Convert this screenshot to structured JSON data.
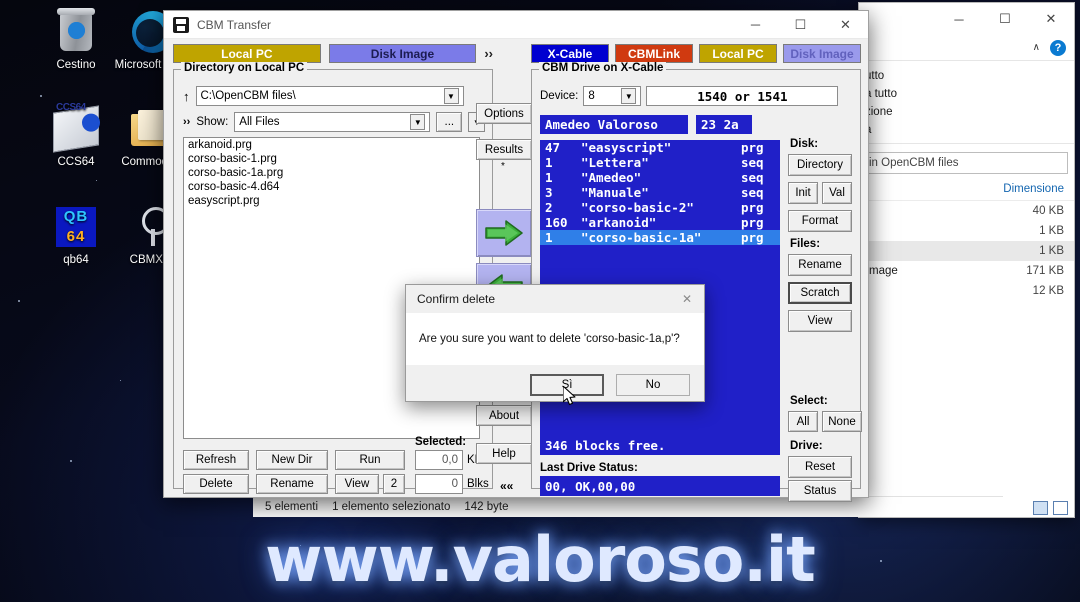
{
  "desktop": {
    "icons": [
      {
        "label": "Cestino",
        "icon": "recycle-bin-icon"
      },
      {
        "label": "Microsoft Edge",
        "icon": "edge-icon"
      },
      {
        "label": "CCS64",
        "icon": "ccs64-icon"
      },
      {
        "label": "Commodore",
        "icon": "folder-icon"
      },
      {
        "label": "qb64",
        "icon": "qb64-icon"
      },
      {
        "label": "CBMXfer",
        "icon": "cbmxfer-icon"
      }
    ],
    "watermark": "www.valoroso.it"
  },
  "explorer": {
    "window_buttons": {
      "minimize": "─",
      "maximize": "☐",
      "close": "✕"
    },
    "ribbon_collapse": "∧",
    "help": "?",
    "ribbon_items": [
      "utto",
      "a tutto",
      "zione",
      "a"
    ],
    "search_placeholder": "in OpenCBM files",
    "column_header": "Dimensione",
    "rows": [
      {
        "name": "",
        "size": "40 KB",
        "selected": false
      },
      {
        "name": "",
        "size": "1 KB",
        "selected": false
      },
      {
        "name": "",
        "size": "1 KB",
        "selected": true
      },
      {
        "name": "mage",
        "size": "171 KB",
        "selected": false
      },
      {
        "name": "",
        "size": "12 KB",
        "selected": false
      }
    ],
    "statusbar": {
      "count": "5 elementi",
      "selection": "1 elemento selezionato",
      "size": "142 byte"
    }
  },
  "cbm": {
    "title": "CBM Transfer",
    "window_buttons": {
      "minimize": "─",
      "maximize": "☐",
      "close": "✕"
    },
    "left_tabs": [
      {
        "label": "Local PC",
        "active": true,
        "bg": "#bfa400",
        "fg": "#ffffff"
      },
      {
        "label": "Disk Image",
        "active": false,
        "bg": "#7b7be8",
        "fg": "#1a1a4a"
      }
    ],
    "left_tabs_more": "››",
    "right_tabs": [
      {
        "label": "X-Cable",
        "bg": "#0000d0",
        "fg": "#ffffff"
      },
      {
        "label": "CBMLink",
        "bg": "#d03a10",
        "fg": "#ffffff"
      },
      {
        "label": "Local PC",
        "bg": "#bfa400",
        "fg": "#ffffff"
      },
      {
        "label": "Disk Image",
        "bg": "#9a9aec",
        "fg": "#5a5ab8"
      }
    ],
    "local": {
      "group_label": "Directory on Local PC",
      "up_icon": "↑",
      "path": "C:\\OpenCBM files\\",
      "more_icon": "››",
      "show_label": "Show:",
      "filter": "All Files",
      "browse_label": "...",
      "files": [
        "arkanoid.prg",
        "corso-basic-1.prg",
        "corso-basic-1a.prg",
        "corso-basic-4.d64",
        "easyscript.prg"
      ],
      "buttons": [
        "Refresh",
        "New Dir",
        "Run",
        "Delete",
        "Rename",
        "View",
        "2"
      ],
      "selected_label": "Selected:",
      "selected_kb": "0,0",
      "selected_kb_unit": "KB",
      "selected_blks": "0",
      "selected_blks_unit": "Blks"
    },
    "middle": {
      "options": "Options",
      "results": "Results",
      "results_mark": "*",
      "arrow_right": "right-arrow",
      "arrow_left": "left-arrow",
      "about": "About",
      "help": "Help",
      "collapse": "««"
    },
    "drive": {
      "group_label": "CBM Drive on X-Cable",
      "device_label": "Device:",
      "device_value": "8",
      "drive_model": "1540 or 1541",
      "disk_name": "Amedeo Valoroso",
      "disk_id": "23 2a",
      "directory": [
        {
          "blocks": "47",
          "name": "\"easyscript\"",
          "type": "prg",
          "selected": false
        },
        {
          "blocks": "1",
          "name": "\"Lettera\"",
          "type": "seq",
          "selected": false
        },
        {
          "blocks": "1",
          "name": "\"Amedeo\"",
          "type": "seq",
          "selected": false
        },
        {
          "blocks": "3",
          "name": "\"Manuale\"",
          "type": "seq",
          "selected": false
        },
        {
          "blocks": "2",
          "name": "\"corso-basic-2\"",
          "type": "prg",
          "selected": false
        },
        {
          "blocks": "160",
          "name": "\"arkanoid\"",
          "type": "prg",
          "selected": false
        },
        {
          "blocks": "1",
          "name": "\"corso-basic-1a\"",
          "type": "prg",
          "selected": true
        }
      ],
      "blocks_free": "346 blocks free.",
      "last_status_label": "Last Drive Status:",
      "last_status": "00, OK,00,00",
      "side": {
        "disk_label": "Disk:",
        "directory": "Directory",
        "init": "Init",
        "val": "Val",
        "format": "Format",
        "files_label": "Files:",
        "rename": "Rename",
        "scratch": "Scratch",
        "view": "View",
        "select_label": "Select:",
        "all": "All",
        "none": "None",
        "drive_label": "Drive:",
        "reset": "Reset",
        "status": "Status"
      }
    }
  },
  "dialog": {
    "title": "Confirm delete",
    "close_icon": "✕",
    "message": "Are you sure you want to delete 'corso-basic-1a,p'?",
    "yes": "Sì",
    "no": "No"
  }
}
